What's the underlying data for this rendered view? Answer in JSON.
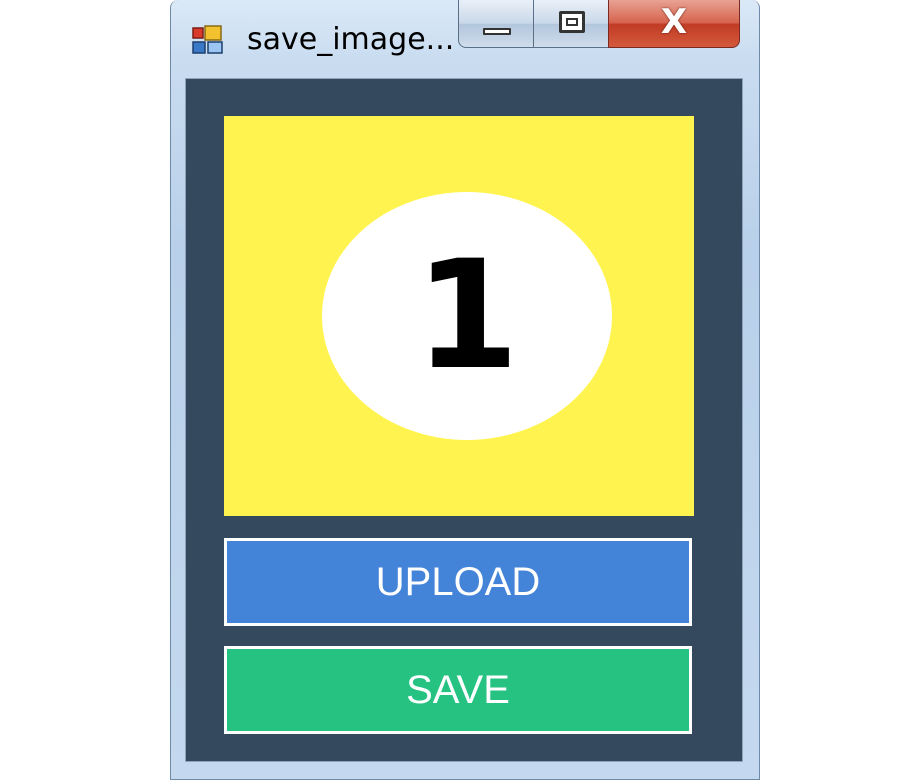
{
  "window": {
    "title": "save_image...",
    "close_glyph": "X"
  },
  "picture": {
    "digit": "1",
    "background_color": "#fff44f"
  },
  "buttons": {
    "upload_label": "UPLOAD",
    "upload_color": "#4383d8",
    "save_label": "SAVE",
    "save_color": "#26c281"
  },
  "colors": {
    "client_background": "#34495e"
  },
  "icons": {
    "app": "app-icon",
    "minimize": "minimize-icon",
    "maximize": "maximize-icon",
    "close": "close-icon"
  }
}
